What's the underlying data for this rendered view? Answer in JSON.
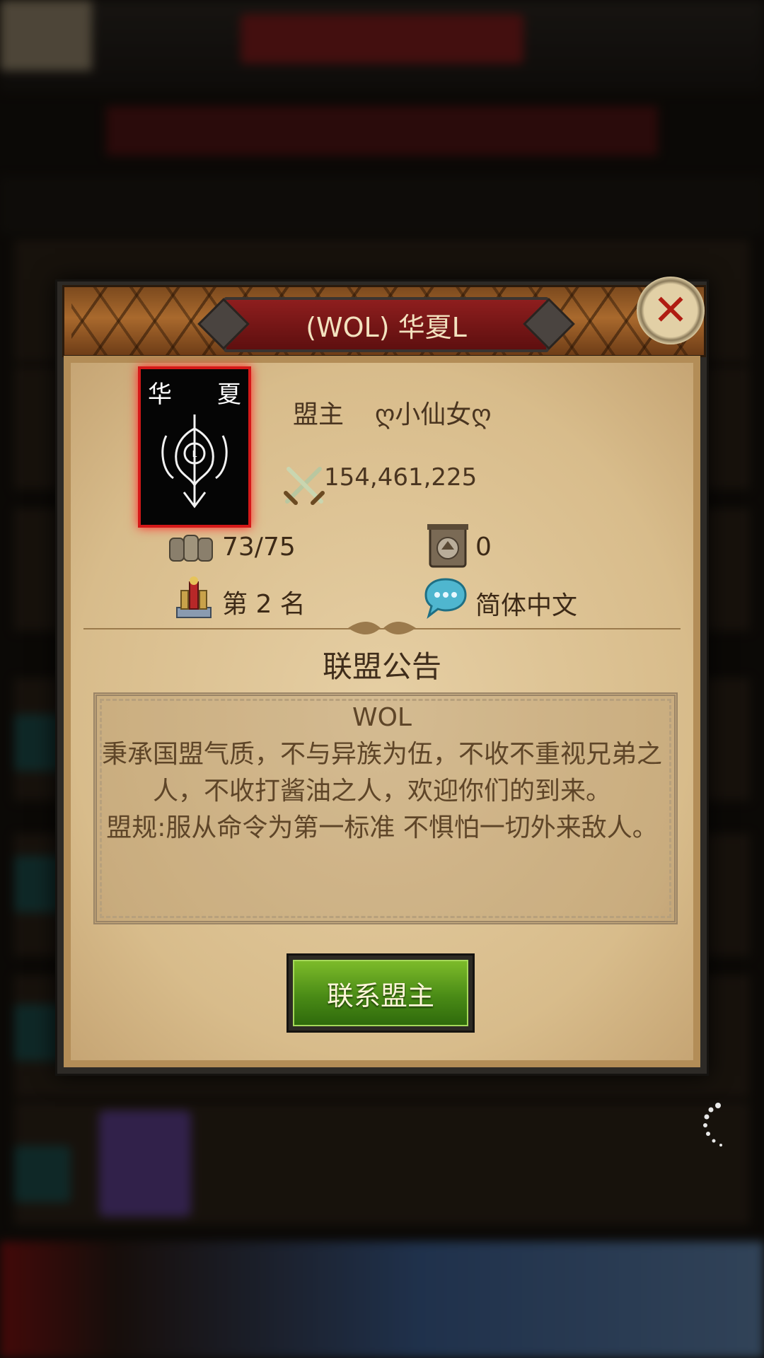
{
  "dialog": {
    "title": "(WOL) 华夏L",
    "flag_chars": [
      "华",
      "夏"
    ],
    "leader_label": "盟主",
    "leader_name": "ღ小仙女ღ",
    "power": "154,461,225",
    "members": "73/75",
    "fortress_count": "0",
    "rank": "第 2 名",
    "language": "简体中文",
    "notice_title": "联盟公告",
    "notice_text": "WOL\n秉承国盟气质，不与异族为伍，不收不重视兄弟之人，不收打酱油之人，欢迎你们的到来。\n盟规:服从命令为第一标准 不惧怕一切外来敌人。",
    "contact_button": "联系盟主"
  },
  "icons": {
    "close": "close-icon",
    "power": "crossed-swords-icon",
    "members": "members-icon",
    "fortress": "fortress-icon",
    "rank": "trophy-icon",
    "language": "chat-bubble-icon"
  },
  "colors": {
    "title_plate": "#8e1e1e",
    "flag_border": "#d41818",
    "button_green": "#4a8b16",
    "parchment": "#e6cfa4"
  }
}
